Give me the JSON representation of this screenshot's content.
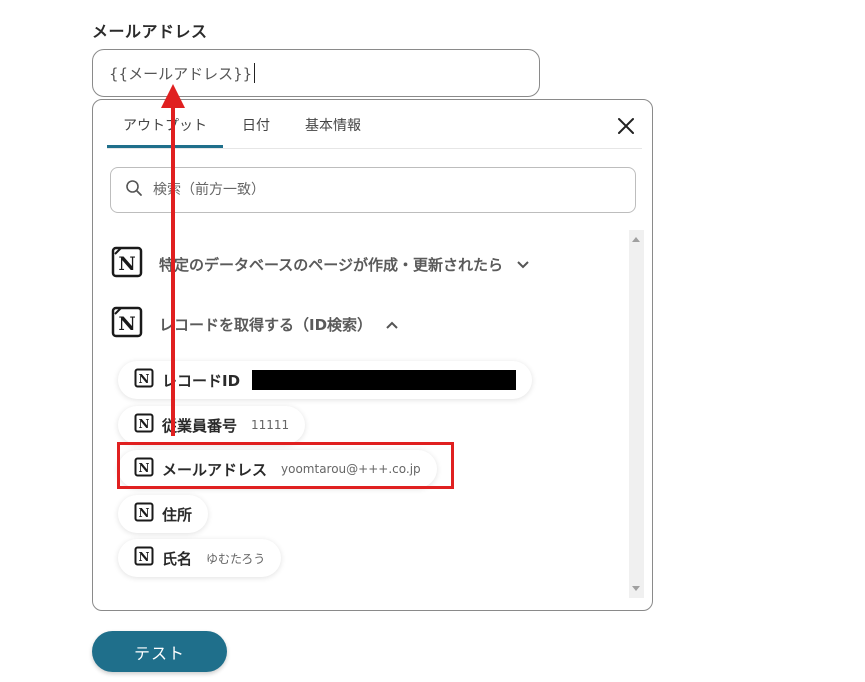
{
  "field": {
    "label": "メールアドレス",
    "value": "{{メールアドレス}}"
  },
  "tabs": [
    {
      "label": "アウトプット",
      "active": true
    },
    {
      "label": "日付",
      "active": false
    },
    {
      "label": "基本情報",
      "active": false
    }
  ],
  "search": {
    "placeholder": "検索（前方一致）"
  },
  "groups": [
    {
      "label": "特定のデータベースのページが作成・更新されたら",
      "expanded": false,
      "icon": "notion-icon"
    },
    {
      "label": "レコードを取得する（ID検索）",
      "expanded": true,
      "icon": "notion-icon"
    }
  ],
  "items": [
    {
      "label": "レコードID",
      "value": "",
      "redacted": true
    },
    {
      "label": "従業員番号",
      "value": "11111"
    },
    {
      "label": "メールアドレス",
      "value": "yoomtarou@+++.co.jp"
    },
    {
      "label": "住所",
      "value": ""
    },
    {
      "label": "氏名",
      "value": "ゆむたろう"
    }
  ],
  "test_button": {
    "label": "テスト"
  },
  "colors": {
    "accent": "#1f6f8b",
    "annotation_red": "#e02020"
  }
}
